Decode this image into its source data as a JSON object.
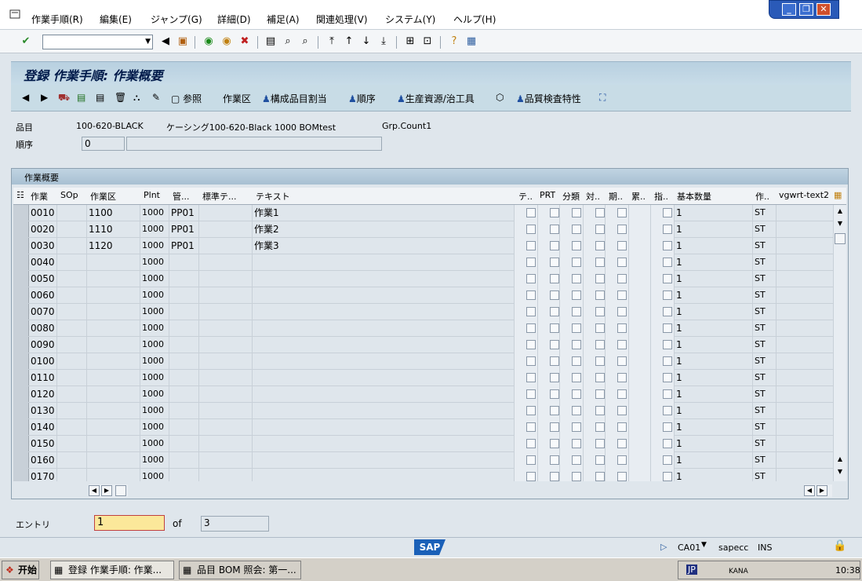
{
  "menu": [
    "作業手順(R)",
    "編集(E)",
    "ジャンプ(G)",
    "詳細(D)",
    "補足(A)",
    "関連処理(V)",
    "システム(Y)",
    "ヘルプ(H)"
  ],
  "window_controls": {
    "minimize": "_",
    "restore": "❐",
    "close": "✕"
  },
  "title": "登録 作業手順: 作業概要",
  "app_toolbar": {
    "reference": "参照",
    "work_area": "作業区",
    "component_assign": "構成品目割当",
    "sequence": "順序",
    "prt": "生産資源/治工具",
    "inspection": "品質検査特性"
  },
  "header": {
    "material_label": "品目",
    "material": "100-620-BLACK",
    "desc": "ケーシング100-620-Black 1000 BOMtest",
    "group": "Grp.Count1",
    "seq_label": "順序",
    "seq": "0"
  },
  "table": {
    "caption": "作業概要",
    "columns": [
      "作業",
      "SOp",
      "作業区",
      "Plnt",
      "管...",
      "標準テ...",
      "テキスト",
      "テ..",
      "PRT",
      "分類",
      "対..",
      "期..",
      "累..",
      "指..",
      "基本数量",
      "作..",
      "vgwrt-text2"
    ],
    "rows": [
      {
        "op": "0010",
        "wc": "1100",
        "plnt": "1000",
        "ctrl": "PP01",
        "text": "作業1",
        "qty": "1",
        "unit": "ST"
      },
      {
        "op": "0020",
        "wc": "1110",
        "plnt": "1000",
        "ctrl": "PP01",
        "text": "作業2",
        "qty": "1",
        "unit": "ST"
      },
      {
        "op": "0030",
        "wc": "1120",
        "plnt": "1000",
        "ctrl": "PP01",
        "text": "作業3",
        "qty": "1",
        "unit": "ST"
      },
      {
        "op": "0040",
        "wc": "",
        "plnt": "1000",
        "ctrl": "",
        "text": "",
        "qty": "1",
        "unit": "ST"
      },
      {
        "op": "0050",
        "wc": "",
        "plnt": "1000",
        "ctrl": "",
        "text": "",
        "qty": "1",
        "unit": "ST"
      },
      {
        "op": "0060",
        "wc": "",
        "plnt": "1000",
        "ctrl": "",
        "text": "",
        "qty": "1",
        "unit": "ST"
      },
      {
        "op": "0070",
        "wc": "",
        "plnt": "1000",
        "ctrl": "",
        "text": "",
        "qty": "1",
        "unit": "ST"
      },
      {
        "op": "0080",
        "wc": "",
        "plnt": "1000",
        "ctrl": "",
        "text": "",
        "qty": "1",
        "unit": "ST"
      },
      {
        "op": "0090",
        "wc": "",
        "plnt": "1000",
        "ctrl": "",
        "text": "",
        "qty": "1",
        "unit": "ST"
      },
      {
        "op": "0100",
        "wc": "",
        "plnt": "1000",
        "ctrl": "",
        "text": "",
        "qty": "1",
        "unit": "ST"
      },
      {
        "op": "0110",
        "wc": "",
        "plnt": "1000",
        "ctrl": "",
        "text": "",
        "qty": "1",
        "unit": "ST"
      },
      {
        "op": "0120",
        "wc": "",
        "plnt": "1000",
        "ctrl": "",
        "text": "",
        "qty": "1",
        "unit": "ST"
      },
      {
        "op": "0130",
        "wc": "",
        "plnt": "1000",
        "ctrl": "",
        "text": "",
        "qty": "1",
        "unit": "ST"
      },
      {
        "op": "0140",
        "wc": "",
        "plnt": "1000",
        "ctrl": "",
        "text": "",
        "qty": "1",
        "unit": "ST"
      },
      {
        "op": "0150",
        "wc": "",
        "plnt": "1000",
        "ctrl": "",
        "text": "",
        "qty": "1",
        "unit": "ST"
      },
      {
        "op": "0160",
        "wc": "",
        "plnt": "1000",
        "ctrl": "",
        "text": "",
        "qty": "1",
        "unit": "ST"
      },
      {
        "op": "0170",
        "wc": "",
        "plnt": "1000",
        "ctrl": "",
        "text": "",
        "qty": "1",
        "unit": "ST"
      }
    ]
  },
  "footer": {
    "entry_label": "エントリ",
    "entry_value": "1",
    "of": "of",
    "total": "3"
  },
  "status": {
    "tcode": "CA01",
    "server": "sapecc",
    "mode": "INS"
  },
  "taskbar": {
    "start": "开始",
    "task1": "登録 作業手順: 作業...",
    "task2": "品目 BOM 照会: 第一...",
    "lang": "JP",
    "ime": "KANA",
    "clock": "10:38"
  }
}
